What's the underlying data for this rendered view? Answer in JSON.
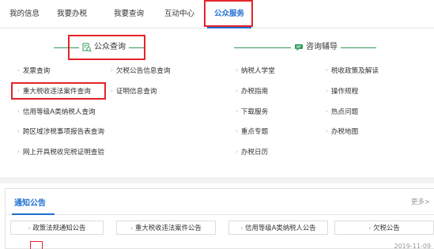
{
  "tabs": [
    {
      "label": "我的信息"
    },
    {
      "label": "我要办税"
    },
    {
      "label": "我要查询"
    },
    {
      "label": "互动中心"
    },
    {
      "label": "公众服务"
    }
  ],
  "public_query": {
    "title": "公众查询",
    "icon": "search-document-icon",
    "links": [
      "发票查询",
      "欠税公告信息查询",
      "重大税收违法案件查询",
      "证明信息查询",
      "信用等级A类纳税人查询",
      "跨区域涉税事项报告表查询",
      "网上开具税收完税证明查验"
    ]
  },
  "consult": {
    "title": "咨询辅导",
    "icon": "chat-bubble-icon",
    "links": [
      "纳税人学堂",
      "税收政策及解读",
      "办税指南",
      "操作规程",
      "下载服务",
      "热点问题",
      "重点专题",
      "办税地图",
      "办税日历"
    ]
  },
  "notice": {
    "title": "通知公告",
    "more": "更多>",
    "pills": [
      "政策法规通知公告",
      "重大税收违法案件公告",
      "信用等级A类纳税人公告",
      "欠税公告"
    ],
    "date_partial": "2019-11-09"
  },
  "colors": {
    "accent": "#1f6fd1",
    "highlight": "#e5232a",
    "section_line": "#2f9b5a"
  }
}
